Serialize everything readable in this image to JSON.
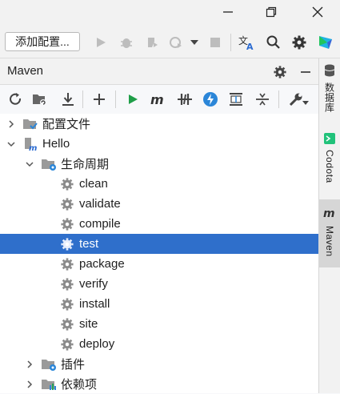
{
  "window": {
    "minimize_icon": "minimize-icon",
    "restore_icon": "restore-icon",
    "close_icon": "close-icon"
  },
  "toolbar": {
    "config_label": "添加配置...",
    "icons": [
      "run-icon",
      "debug-icon",
      "coverage-icon",
      "profile-icon",
      "dropdown-icon",
      "stop-icon",
      "translate-icon",
      "search-icon",
      "settings-icon",
      "jetbrains-logo-icon"
    ]
  },
  "panel": {
    "title": "Maven",
    "header_icons": [
      "gear-icon",
      "hide-icon"
    ],
    "toolbar_icons": [
      "reload-icon",
      "add-project-icon",
      "download-icon",
      "plus-icon",
      "run-maven-icon",
      "maven-goal-icon",
      "skip-tests-icon",
      "offline-icon",
      "show-dependencies-icon",
      "collapse-icon",
      "settings-wrench-icon"
    ]
  },
  "tree": {
    "items": [
      {
        "label": "配置文件",
        "level": 0,
        "expanded": false,
        "icon": "profiles-folder-icon"
      },
      {
        "label": "Hello",
        "level": 0,
        "expanded": true,
        "icon": "maven-project-icon"
      },
      {
        "label": "生命周期",
        "level": 1,
        "expanded": true,
        "icon": "lifecycle-folder-icon"
      },
      {
        "label": "clean",
        "level": 2,
        "icon": "gear-icon"
      },
      {
        "label": "validate",
        "level": 2,
        "icon": "gear-icon"
      },
      {
        "label": "compile",
        "level": 2,
        "icon": "gear-icon"
      },
      {
        "label": "test",
        "level": 2,
        "icon": "gear-icon",
        "selected": true
      },
      {
        "label": "package",
        "level": 2,
        "icon": "gear-icon"
      },
      {
        "label": "verify",
        "level": 2,
        "icon": "gear-icon"
      },
      {
        "label": "install",
        "level": 2,
        "icon": "gear-icon"
      },
      {
        "label": "site",
        "level": 2,
        "icon": "gear-icon"
      },
      {
        "label": "deploy",
        "level": 2,
        "icon": "gear-icon"
      },
      {
        "label": "插件",
        "level": 1,
        "expanded": false,
        "icon": "plugins-folder-icon"
      },
      {
        "label": "依赖项",
        "level": 1,
        "expanded": false,
        "icon": "dependencies-folder-icon"
      }
    ]
  },
  "right_tabs": {
    "database": "数据库",
    "codota": "Codota",
    "maven": "Maven"
  }
}
